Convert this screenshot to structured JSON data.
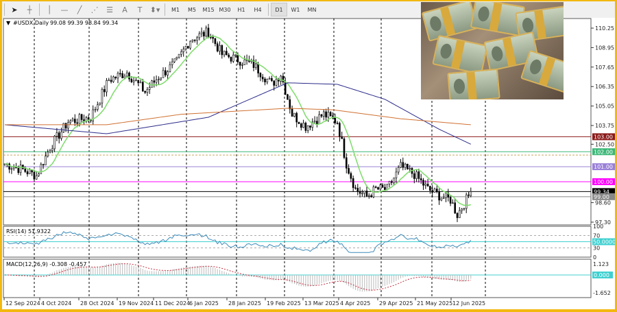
{
  "toolbar": {
    "tools": [
      "cursor-icon",
      "crosshair-icon",
      "vertical-line-icon",
      "horizontal-line-icon",
      "trendline-icon",
      "fibonacci-icon",
      "channels-icon",
      "text-icon",
      "text-label-icon",
      "shapes-icon"
    ],
    "text_tool": "A",
    "timeframes": [
      "M1",
      "M5",
      "M15",
      "M30",
      "H1",
      "H4",
      "D1",
      "W1",
      "MN"
    ],
    "active_timeframe": "D1"
  },
  "chart": {
    "symbol_label": "#USDX,Daily",
    "ohlc": "99.08 99.39 98.84 99.34",
    "price_ticks": [
      "110.25",
      "108.95",
      "107.65",
      "106.35",
      "105.05",
      "103.75",
      "102.50",
      "98.60",
      "97.30"
    ],
    "levels": [
      {
        "label": "103.00",
        "value": 103.0,
        "color": "#8b1a1a"
      },
      {
        "label": "102.00",
        "value": 102.0,
        "color": "#3cb878"
      },
      {
        "label": "101.00",
        "value": 101.0,
        "color": "#9a80d8"
      },
      {
        "label": "100.00",
        "value": 100.0,
        "color": "#ff00ff"
      },
      {
        "label": "99.34",
        "value": 99.34,
        "color": "#000000"
      },
      {
        "label": "99.00",
        "value": 99.0,
        "color": "#888888"
      }
    ],
    "dates": [
      "12 Sep 2024",
      "4 Oct 2024",
      "28 Oct 2024",
      "19 Nov 2024",
      "11 Dec 2024",
      "6 Jan 2025",
      "28 Jan 2025",
      "19 Feb 2025",
      "13 Mar 2025",
      "4 Apr 2025",
      "29 Apr 2025",
      "21 May 2025",
      "12 Jun 2025"
    ]
  },
  "rsi": {
    "label": "RSI(14) 51.9322",
    "ticks": [
      "100",
      "70",
      "30",
      "0"
    ],
    "level_label": "50.0000"
  },
  "macd": {
    "label": "MACD(12,26,9) -0.308 -0.457",
    "ticks": [
      "1.123",
      "-1.652"
    ],
    "level_label": "0.000"
  },
  "chart_data": {
    "type": "candlestick",
    "close_keypoints": [
      [
        0,
        101.2
      ],
      [
        8,
        100.8
      ],
      [
        14,
        100.4
      ],
      [
        20,
        102.3
      ],
      [
        28,
        104.0
      ],
      [
        38,
        104.3
      ],
      [
        46,
        106.8
      ],
      [
        54,
        107.3
      ],
      [
        62,
        106.0
      ],
      [
        68,
        107.0
      ],
      [
        76,
        108.0
      ],
      [
        82,
        109.5
      ],
      [
        90,
        110.0
      ],
      [
        96,
        108.5
      ],
      [
        104,
        108.1
      ],
      [
        110,
        107.8
      ],
      [
        118,
        106.5
      ],
      [
        122,
        107.2
      ],
      [
        127,
        104.5
      ],
      [
        133,
        103.7
      ],
      [
        141,
        104.5
      ],
      [
        147,
        104.0
      ],
      [
        151,
        101.2
      ],
      [
        155,
        99.5
      ],
      [
        160,
        99.0
      ],
      [
        164,
        99.5
      ],
      [
        169,
        99.5
      ],
      [
        175,
        101.0
      ],
      [
        181,
        100.5
      ],
      [
        187,
        99.5
      ],
      [
        193,
        99.0
      ],
      [
        197,
        98.8
      ],
      [
        200,
        97.8
      ],
      [
        204,
        98.8
      ],
      [
        206,
        99.34
      ]
    ],
    "ma_slow": [
      [
        0,
        103.8
      ],
      [
        45,
        103.2
      ],
      [
        90,
        104.3
      ],
      [
        125,
        106.6
      ],
      [
        147,
        106.5
      ],
      [
        168,
        105.5
      ],
      [
        192,
        103.5
      ],
      [
        206,
        102.5
      ]
    ],
    "ma_200": [
      [
        0,
        103.8
      ],
      [
        45,
        103.8
      ],
      [
        78,
        104.5
      ],
      [
        125,
        104.9
      ],
      [
        145,
        104.8
      ],
      [
        175,
        104.2
      ],
      [
        206,
        103.8
      ]
    ]
  }
}
